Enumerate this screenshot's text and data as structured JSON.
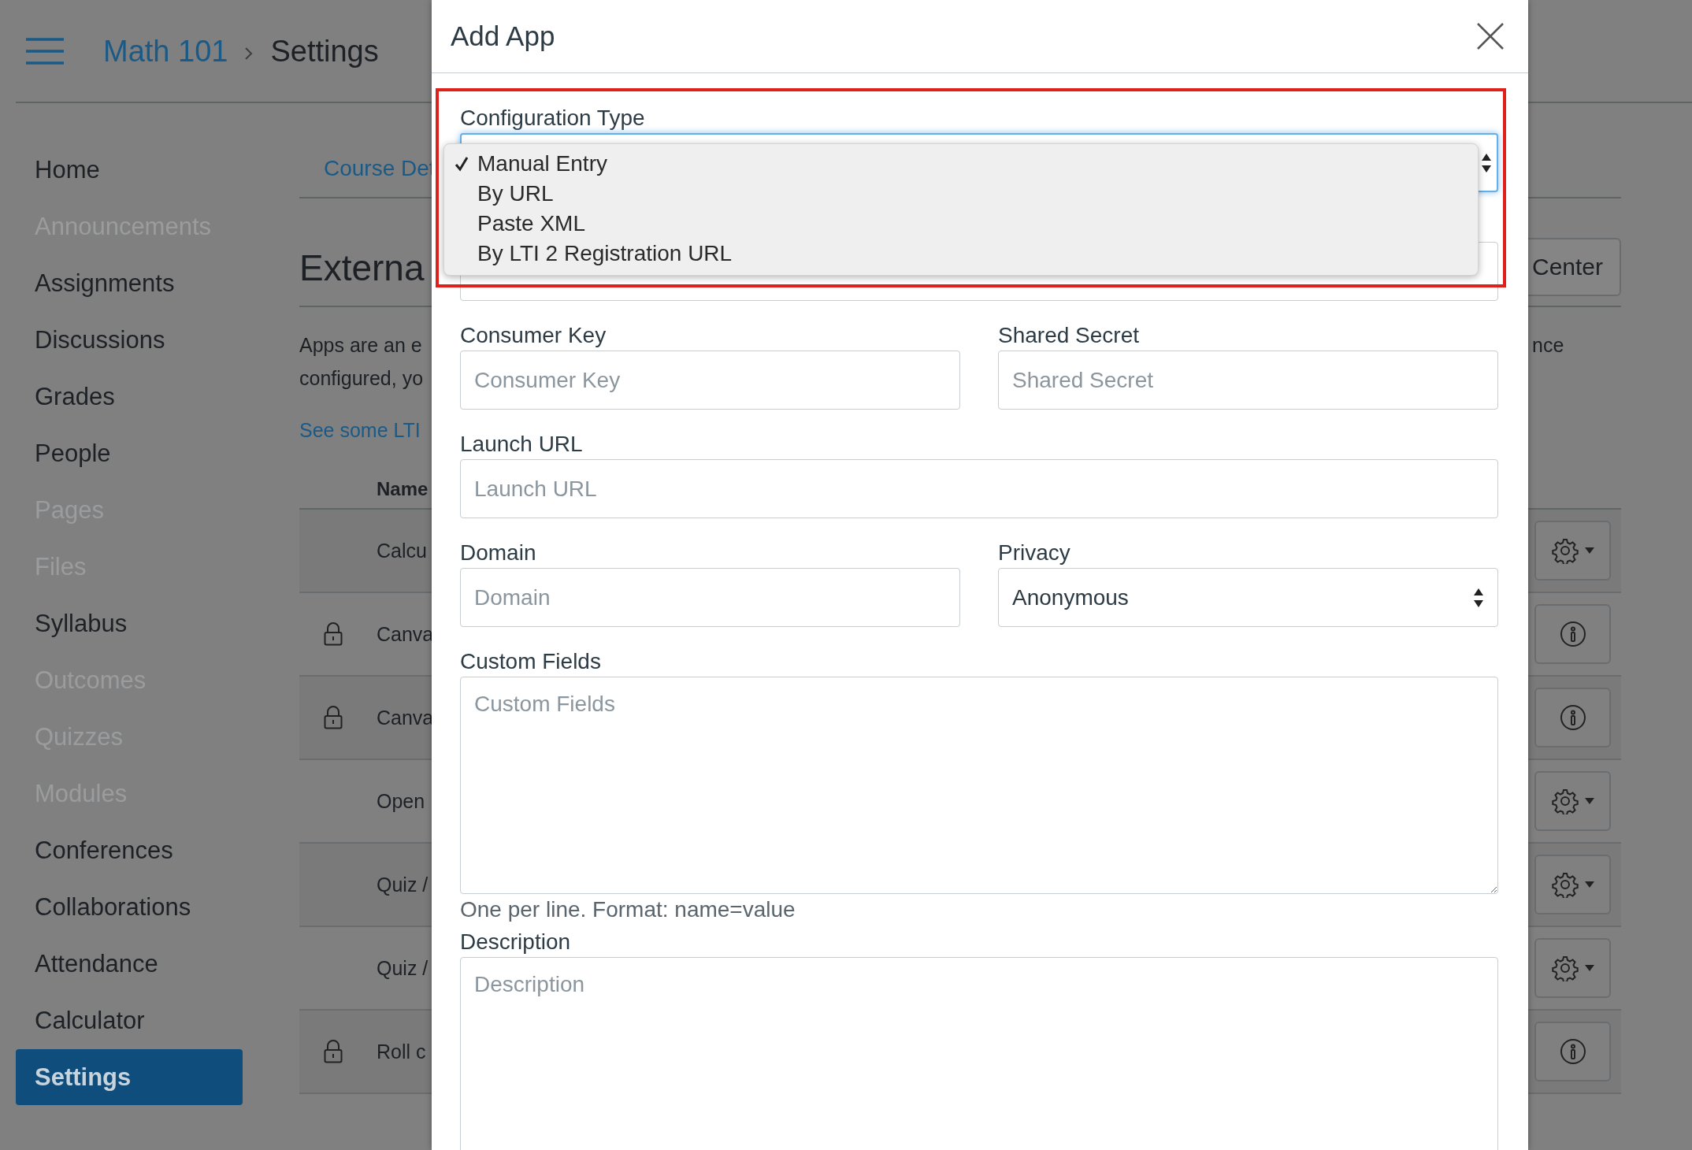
{
  "header": {
    "breadcrumb": [
      {
        "label": "Math 101",
        "kind": "link"
      },
      {
        "label": "Settings",
        "kind": "current"
      }
    ]
  },
  "sidebar": {
    "items": [
      {
        "label": "Home",
        "disabled": false,
        "selected": false
      },
      {
        "label": "Announcements",
        "disabled": true,
        "selected": false
      },
      {
        "label": "Assignments",
        "disabled": false,
        "selected": false
      },
      {
        "label": "Discussions",
        "disabled": false,
        "selected": false
      },
      {
        "label": "Grades",
        "disabled": false,
        "selected": false
      },
      {
        "label": "People",
        "disabled": false,
        "selected": false
      },
      {
        "label": "Pages",
        "disabled": true,
        "selected": false
      },
      {
        "label": "Files",
        "disabled": true,
        "selected": false
      },
      {
        "label": "Syllabus",
        "disabled": false,
        "selected": false
      },
      {
        "label": "Outcomes",
        "disabled": true,
        "selected": false
      },
      {
        "label": "Quizzes",
        "disabled": true,
        "selected": false
      },
      {
        "label": "Modules",
        "disabled": true,
        "selected": false
      },
      {
        "label": "Conferences",
        "disabled": false,
        "selected": false
      },
      {
        "label": "Collaborations",
        "disabled": false,
        "selected": false
      },
      {
        "label": "Attendance",
        "disabled": false,
        "selected": false
      },
      {
        "label": "Calculator",
        "disabled": false,
        "selected": false
      },
      {
        "label": "Settings",
        "disabled": false,
        "selected": true
      }
    ]
  },
  "content": {
    "tab": "Course Det",
    "heading": "Externa",
    "action_button": "Center",
    "intro_lines": [
      "Apps are an e",
      "configured, yo"
    ],
    "intro_right": "nce",
    "link": "See some LTI",
    "table": {
      "columns": [
        "Name"
      ],
      "rows": [
        {
          "name": "Calcu",
          "locked": false,
          "kind": "settings"
        },
        {
          "name": "Canva",
          "locked": true,
          "kind": "info"
        },
        {
          "name": "Canva",
          "locked": true,
          "kind": "info"
        },
        {
          "name": "Open",
          "locked": false,
          "kind": "settings"
        },
        {
          "name": "Quiz /",
          "locked": false,
          "kind": "settings"
        },
        {
          "name": "Quiz /",
          "locked": false,
          "kind": "settings"
        },
        {
          "name": "Roll c",
          "locked": true,
          "kind": "info"
        }
      ]
    }
  },
  "dialog": {
    "title": "Add App",
    "config_type": {
      "label": "Configuration Type",
      "options": [
        {
          "label": "Manual Entry",
          "selected": true
        },
        {
          "label": "By URL",
          "selected": false
        },
        {
          "label": "Paste XML",
          "selected": false
        },
        {
          "label": "By LTI 2 Registration URL",
          "selected": false
        }
      ]
    },
    "rows": [
      [
        {
          "kind": "text",
          "label": "Consumer Key",
          "placeholder": "Consumer Key"
        },
        {
          "kind": "text",
          "label": "Shared Secret",
          "placeholder": "Shared Secret"
        }
      ],
      [
        {
          "kind": "text",
          "label": "Launch URL",
          "placeholder": "Launch URL"
        }
      ],
      [
        {
          "kind": "text",
          "label": "Domain",
          "placeholder": "Domain"
        },
        {
          "kind": "select",
          "label": "Privacy",
          "value": "Anonymous"
        }
      ],
      [
        {
          "kind": "textarea",
          "label": "Custom Fields",
          "placeholder": "Custom Fields",
          "help": "One per line. Format: name=value"
        }
      ],
      [
        {
          "kind": "textarea",
          "label": "Description",
          "placeholder": "Description"
        }
      ]
    ]
  }
}
